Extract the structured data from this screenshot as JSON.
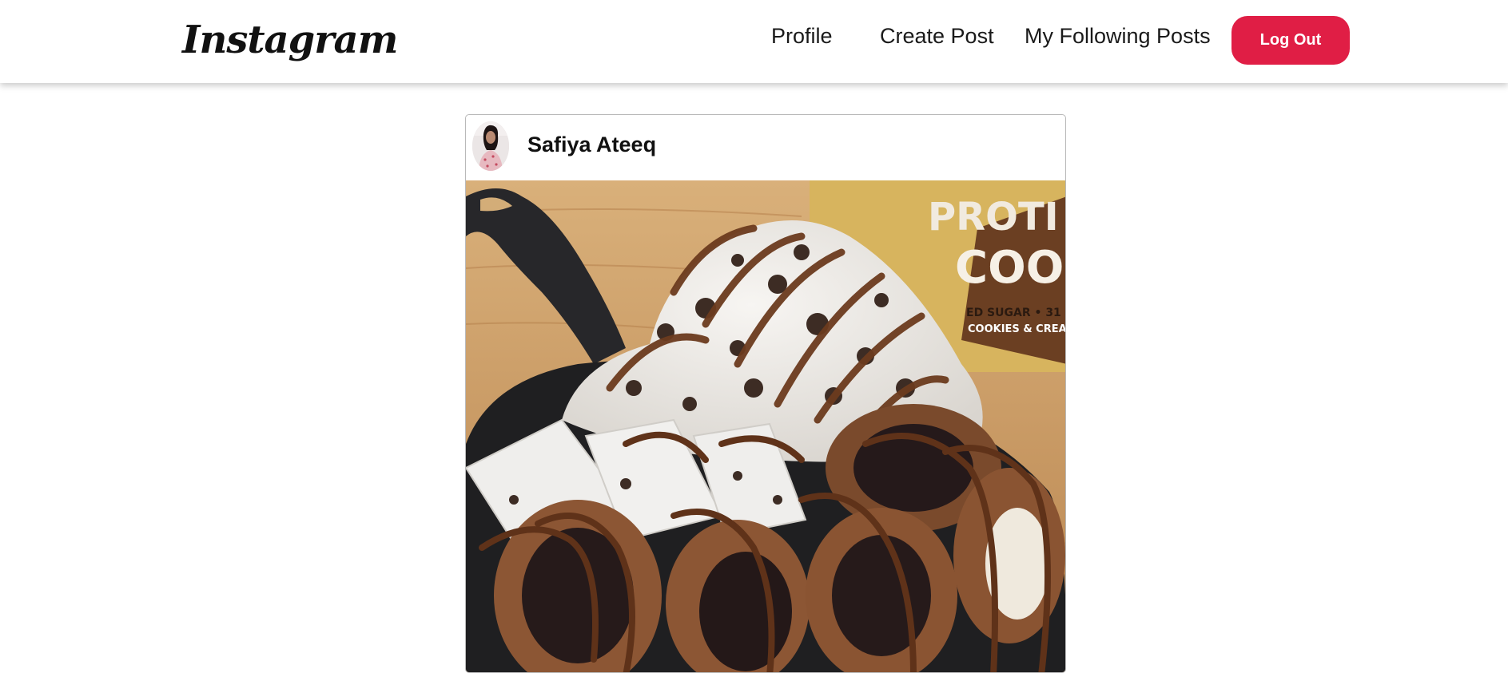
{
  "app": {
    "logo_text": "Instagram"
  },
  "nav": {
    "profile": "Profile",
    "create_post": "Create Post",
    "following_posts": "My Following Posts",
    "logout": "Log Out"
  },
  "post": {
    "username": "Safiya Ateeq",
    "image_text_line1": "PROTI",
    "image_text_line2": "COOKI",
    "image_text_line3": "ED SUGAR • 31",
    "image_text_line4": "COOKIES & CREAM"
  },
  "colors": {
    "logout_bg": "#e01e45",
    "card_border": "#b9b9b9"
  },
  "icons": {
    "avatar": "user-photo-avatar"
  }
}
